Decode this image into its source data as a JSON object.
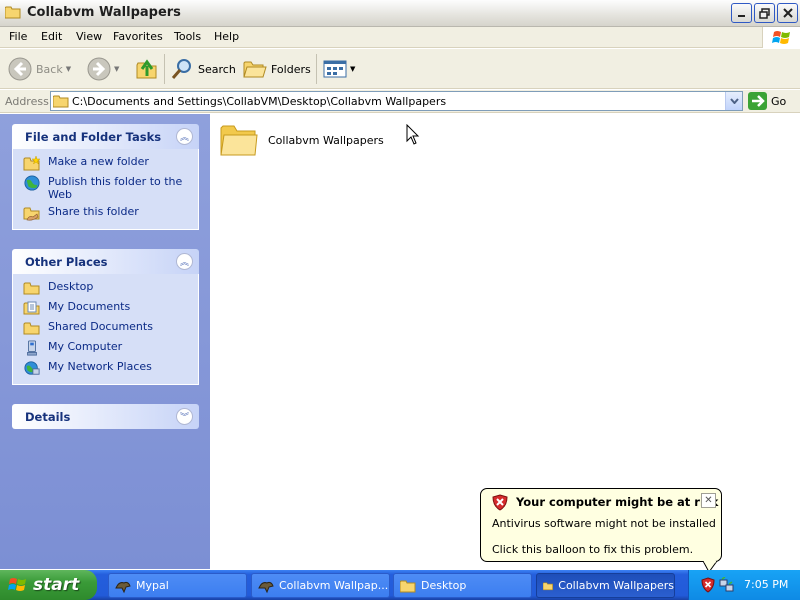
{
  "window": {
    "title": "Collabvm Wallpapers",
    "icon": "folder-icon",
    "controls": [
      "minimize-icon",
      "maximize-icon",
      "close-icon"
    ]
  },
  "menu": {
    "items": [
      "File",
      "Edit",
      "View",
      "Favorites",
      "Tools",
      "Help"
    ]
  },
  "toolbar": {
    "back_label": "Back",
    "search_label": "Search",
    "folders_label": "Folders"
  },
  "address": {
    "label": "Address",
    "path": "C:\\Documents and Settings\\CollabVM\\Desktop\\Collabvm Wallpapers",
    "go_label": "Go"
  },
  "sidebar": {
    "file_tasks": {
      "title": "File and Folder Tasks",
      "items": [
        {
          "label": "Make a new folder",
          "icon": "new-folder-icon"
        },
        {
          "label": "Publish this folder to the Web",
          "icon": "publish-web-icon"
        },
        {
          "label": "Share this folder",
          "icon": "share-folder-icon"
        }
      ]
    },
    "other_places": {
      "title": "Other Places",
      "items": [
        {
          "label": "Desktop",
          "icon": "desktop-folder-icon"
        },
        {
          "label": "My Documents",
          "icon": "my-documents-icon"
        },
        {
          "label": "Shared Documents",
          "icon": "shared-documents-icon"
        },
        {
          "label": "My Computer",
          "icon": "my-computer-icon"
        },
        {
          "label": "My Network Places",
          "icon": "network-places-icon"
        }
      ]
    },
    "details": {
      "title": "Details"
    }
  },
  "content": {
    "items": [
      {
        "name": "Collabvm Wallpapers",
        "icon": "folder-icon"
      }
    ]
  },
  "taskbar": {
    "start_label": "start",
    "buttons": [
      {
        "label": "Mypal",
        "active": false
      },
      {
        "label": "Collabvm Wallpap...",
        "active": false
      },
      {
        "label": "Desktop",
        "active": false
      },
      {
        "label": "Collabvm Wallpapers",
        "active": true
      }
    ],
    "clock": "7:05 PM"
  },
  "balloon": {
    "title": "Your computer might be at risk",
    "line1": "Antivirus software might not be installed",
    "line2": "Click this balloon to fix this problem."
  },
  "colors": {
    "taskbar_blue": "#245edc",
    "start_green": "#3a9b38",
    "panel_blue": "#d6dff7",
    "link_blue": "#0b2a86"
  }
}
